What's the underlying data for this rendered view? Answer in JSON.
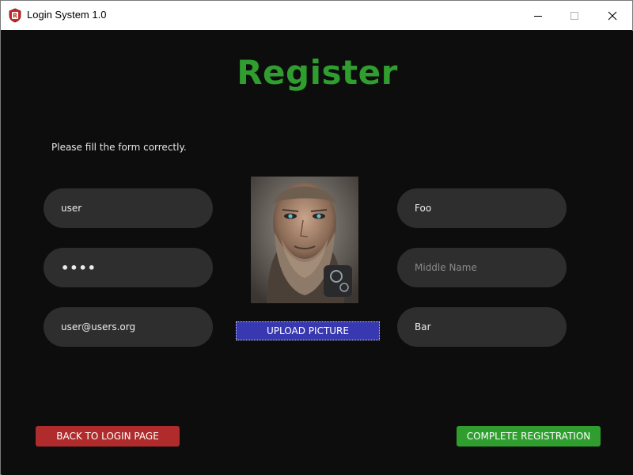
{
  "window": {
    "title": "Login System 1.0",
    "app_icon": "app-logo-icon",
    "controls": [
      "minimize-icon",
      "maximize-icon",
      "close-icon"
    ]
  },
  "page": {
    "heading": "Register",
    "subtitle": "Please fill the form correctly."
  },
  "form": {
    "username": {
      "value": "user"
    },
    "password": {
      "value": "••••"
    },
    "email": {
      "value": "user@users.org"
    },
    "first_name": {
      "value": "Foo"
    },
    "middle_name": {
      "value": "",
      "placeholder": "Middle Name"
    },
    "last_name": {
      "value": "Bar"
    }
  },
  "picture": {
    "upload_label": "UPLOAD PICTURE"
  },
  "actions": {
    "back_label": "BACK TO LOGIN PAGE",
    "complete_label": "COMPLETE REGISTRATION"
  },
  "colors": {
    "heading": "#2f9e2f",
    "background": "#0d0d0d",
    "field": "#2e2e2e",
    "upload": "#3838b0",
    "back": "#b02c2c",
    "complete": "#2f9e2f"
  }
}
